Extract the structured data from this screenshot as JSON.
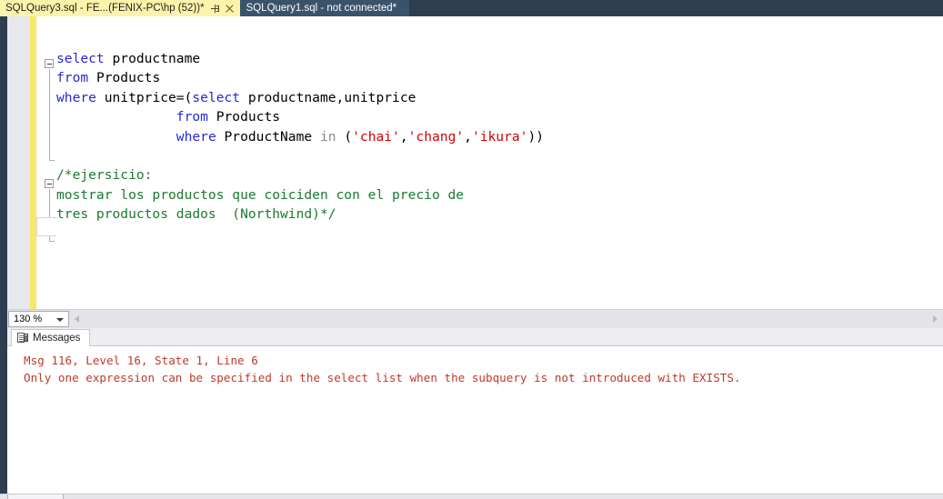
{
  "tabs": [
    {
      "label": "SQLQuery3.sql - FE...(FENIX-PC\\hp (52))*",
      "active": true,
      "pin_icon": "pin-icon",
      "close_icon": "close-icon"
    },
    {
      "label": "SQLQuery1.sql - not connected*",
      "active": false
    }
  ],
  "editor": {
    "lines": [
      {
        "fold": "collapse-minus",
        "tokens": [
          {
            "t": "select",
            "c": "kw"
          },
          {
            "t": " productname",
            "c": "pln"
          }
        ]
      },
      {
        "tokens": [
          {
            "t": "from",
            "c": "kw"
          },
          {
            "t": " Products",
            "c": "pln"
          }
        ]
      },
      {
        "tokens": [
          {
            "t": "where",
            "c": "kw"
          },
          {
            "t": " unitprice=(",
            "c": "pln"
          },
          {
            "t": "select",
            "c": "kw"
          },
          {
            "t": " productname,unitprice",
            "c": "pln"
          }
        ]
      },
      {
        "tokens": [
          {
            "t": "               ",
            "c": "pln"
          },
          {
            "t": "from",
            "c": "kw"
          },
          {
            "t": " Products",
            "c": "pln"
          }
        ]
      },
      {
        "tokens": [
          {
            "t": "               ",
            "c": "pln"
          },
          {
            "t": "where",
            "c": "kw"
          },
          {
            "t": " ProductName ",
            "c": "pln"
          },
          {
            "t": "in",
            "c": "kw2"
          },
          {
            "t": " (",
            "c": "pln"
          },
          {
            "t": "'chai'",
            "c": "str"
          },
          {
            "t": ",",
            "c": "pln"
          },
          {
            "t": "'chang'",
            "c": "str"
          },
          {
            "t": ",",
            "c": "pln"
          },
          {
            "t": "'ikura'",
            "c": "str"
          },
          {
            "t": "))",
            "c": "pln"
          }
        ]
      },
      {
        "tokens": []
      },
      {
        "fold": "collapse-minus",
        "tokens": [
          {
            "t": "/*ejersicio:",
            "c": "cmt"
          }
        ]
      },
      {
        "tokens": [
          {
            "t": "mostrar los productos que coiciden con el precio de",
            "c": "cmt"
          }
        ]
      },
      {
        "current": true,
        "tokens": [
          {
            "t": "tres productos dados  (Northwind)*/",
            "c": "cmt"
          }
        ]
      }
    ]
  },
  "hbar": {
    "zoom_value": "130 %",
    "zoom_dropdown_icon": "chevron-down-icon",
    "scroll_left_icon": "scroll-left-arrow-icon",
    "scroll_right_icon": "scroll-right-arrow-icon"
  },
  "results": {
    "tab_label": "Messages",
    "tab_icon": "messages-icon",
    "messages": [
      "Msg 116, Level 16, State 1, Line 6",
      "Only one expression can be specified in the select list when the subquery is not introduced with EXISTS."
    ]
  },
  "colors": {
    "tab_active_bg": "#fdf3ab",
    "tab_inactive_bg": "#3a536b",
    "chrome_dark": "#2d3e50",
    "change_bar": "#f6e96a",
    "keyword": "#2727d4",
    "string": "#d40000",
    "comment": "#1a7a2e",
    "error_text": "#c0392b"
  }
}
